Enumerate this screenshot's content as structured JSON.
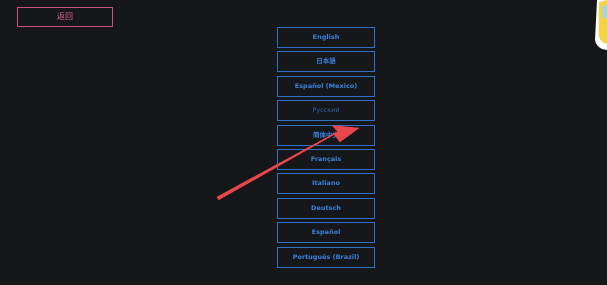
{
  "back_button": {
    "label": "返回"
  },
  "languages": [
    {
      "label": "English",
      "selected": false
    },
    {
      "label": "日本語",
      "selected": false
    },
    {
      "label": "Español (Mexico)",
      "selected": false
    },
    {
      "label": "Русский",
      "selected": true
    },
    {
      "label": "简体中文",
      "selected": false
    },
    {
      "label": "Français",
      "selected": false
    },
    {
      "label": "Italiano",
      "selected": false
    },
    {
      "label": "Deutsch",
      "selected": false
    },
    {
      "label": "Español",
      "selected": false
    },
    {
      "label": "Português (Brazil)",
      "selected": false
    }
  ],
  "colors": {
    "background": "#16171b",
    "back_button": "#e2678f",
    "language_button": "#3a82dd",
    "annotation_arrow": "#e8474c"
  },
  "annotation": {
    "icon": "arrow-annotation-icon"
  }
}
